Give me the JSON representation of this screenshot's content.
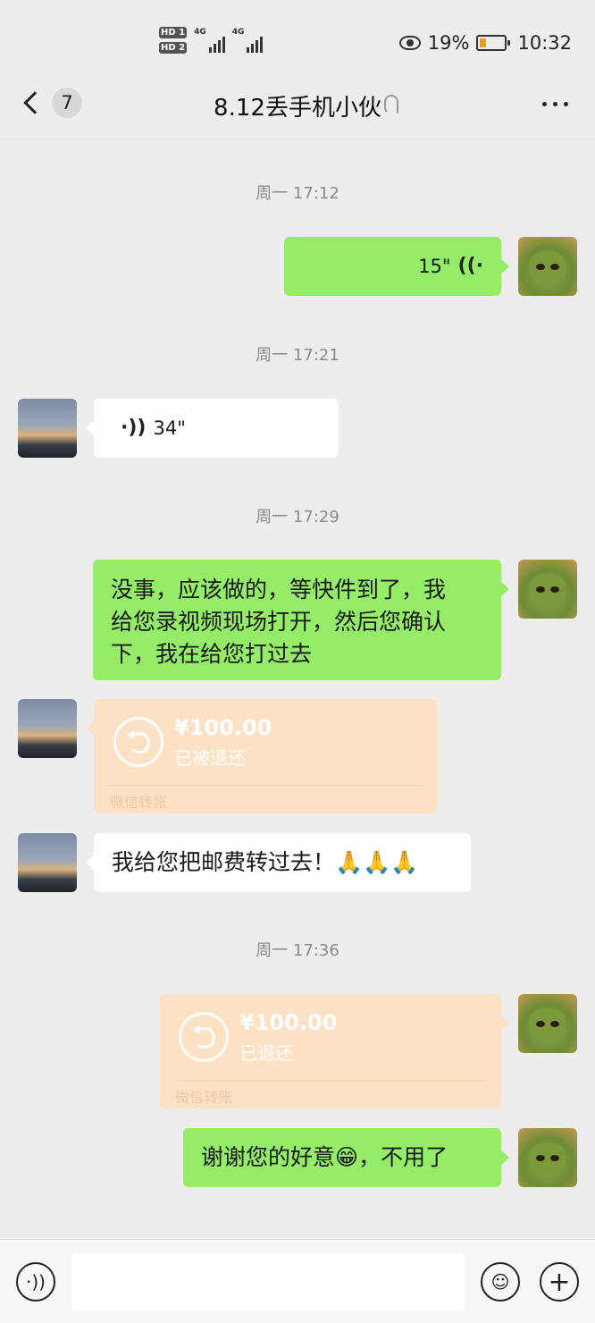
{
  "status_bar": {
    "sim1": "HD 1",
    "sim2": "HD 2",
    "net1": "4G",
    "net2": "4G",
    "battery": "19%",
    "time": "10:32",
    "icons": [
      "eye-icon",
      "battery-icon",
      "signal-icon"
    ]
  },
  "header": {
    "back_badge": "7",
    "title": "8.12丢手机小伙",
    "icons": [
      "chevron-left-icon",
      "ear-icon",
      "more-icon"
    ]
  },
  "messages": [
    {
      "type": "timestamp",
      "text": "周一 17:12"
    },
    {
      "type": "voice",
      "from": "me",
      "duration": "15\""
    },
    {
      "type": "timestamp",
      "text": "周一 17:21"
    },
    {
      "type": "voice",
      "from": "other",
      "duration": "34\""
    },
    {
      "type": "timestamp",
      "text": "周一 17:29"
    },
    {
      "type": "text",
      "from": "me",
      "lines": [
        "没事，应该做的，等快件到了，我",
        "给您录视频现场打开，然后您确认",
        "下，我在给您打过去"
      ]
    },
    {
      "type": "transfer",
      "from": "other",
      "amount": "¥100.00",
      "status": "已被退还",
      "footer": "微信转账"
    },
    {
      "type": "text",
      "from": "other",
      "text": "我给您把邮费转过去！🙏🙏🙏"
    },
    {
      "type": "timestamp",
      "text": "周一 17:36"
    },
    {
      "type": "transfer",
      "from": "me",
      "amount": "¥100.00",
      "status": "已退还",
      "footer": "微信转账"
    },
    {
      "type": "text",
      "from": "me",
      "text": "谢谢您的好意😁，不用了"
    }
  ],
  "input_bar": {
    "placeholder": "",
    "icons": [
      "voice-input-icon",
      "emoji-icon",
      "plus-icon"
    ]
  },
  "colors": {
    "background": "#ededed",
    "bubble_out": "#95ec69",
    "bubble_in": "#ffffff",
    "transfer": "#fde1c5"
  }
}
